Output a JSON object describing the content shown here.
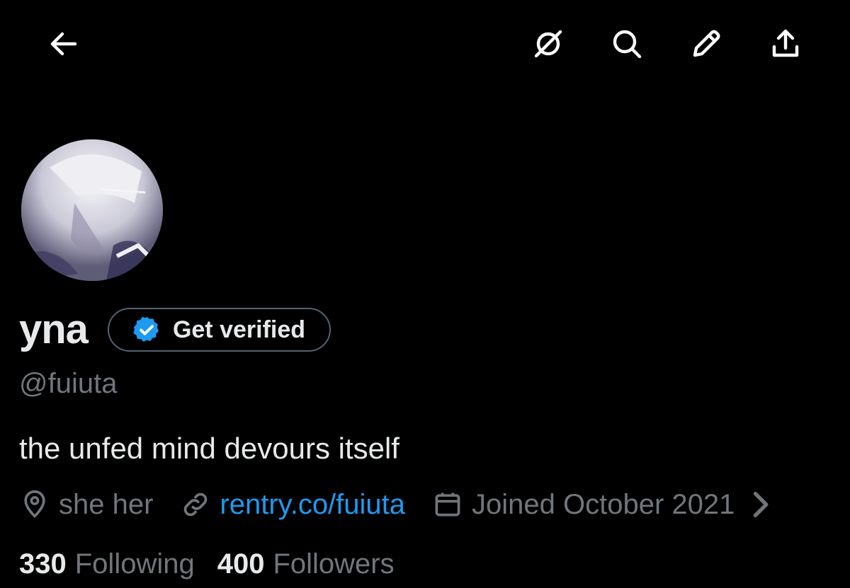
{
  "header": {
    "icons": {
      "back": "arrow-left-icon",
      "grok": "grok-icon",
      "search": "search-icon",
      "edit": "pencil-icon",
      "share": "share-icon"
    }
  },
  "profile": {
    "display_name": "yna",
    "get_verified_label": "Get verified",
    "handle": "@fuiuta",
    "bio": "the unfed mind devours itself",
    "location": "she her",
    "website": "rentry.co/fuiuta",
    "joined": "Joined October 2021",
    "following_count": "330",
    "following_label": "Following",
    "followers_count": "400",
    "followers_label": "Followers"
  },
  "colors": {
    "background": "#000000",
    "text_primary": "#e7e9ea",
    "text_secondary": "#71767b",
    "link": "#1d9bf0",
    "verified_badge": "#1d9bf0"
  }
}
